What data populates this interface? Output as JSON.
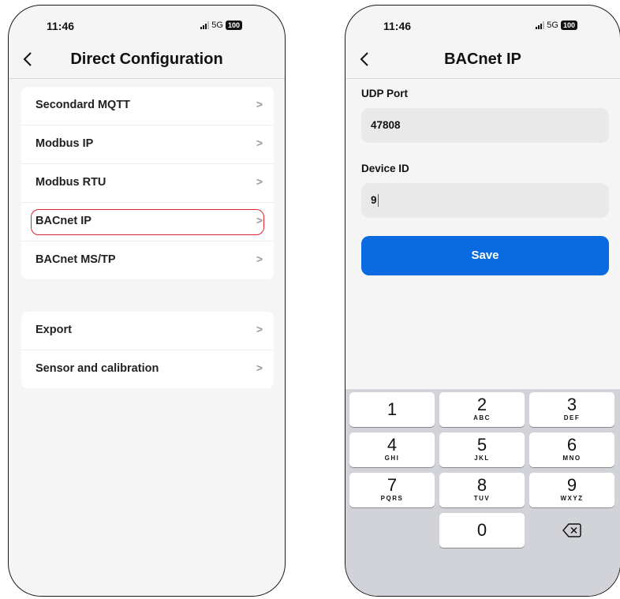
{
  "left_screen": {
    "status": {
      "time": "11:46",
      "network": "5G",
      "battery": "100"
    },
    "nav_title": "Direct Configuration",
    "group1": [
      {
        "label": "Secondard MQTT"
      },
      {
        "label": "Modbus IP"
      },
      {
        "label": "Modbus RTU"
      },
      {
        "label": "BACnet IP",
        "highlighted": true
      },
      {
        "label": "BACnet MS/TP"
      }
    ],
    "group2": [
      {
        "label": "Export"
      },
      {
        "label": "Sensor and calibration"
      }
    ],
    "chevron": ">"
  },
  "right_screen": {
    "status": {
      "time": "11:46",
      "network": "5G",
      "battery": "100"
    },
    "nav_title": "BACnet IP",
    "udp_port_label": "UDP Port",
    "udp_port_value": "47808",
    "device_id_label": "Device ID",
    "device_id_value": "9",
    "save_label": "Save",
    "keypad": [
      {
        "digit": "1",
        "letters": ""
      },
      {
        "digit": "2",
        "letters": "ABC"
      },
      {
        "digit": "3",
        "letters": "DEF"
      },
      {
        "digit": "4",
        "letters": "GHI"
      },
      {
        "digit": "5",
        "letters": "JKL"
      },
      {
        "digit": "6",
        "letters": "MNO"
      },
      {
        "digit": "7",
        "letters": "PQRS"
      },
      {
        "digit": "8",
        "letters": "TUV"
      },
      {
        "digit": "9",
        "letters": "WXYZ"
      },
      {
        "digit": "0",
        "letters": ""
      }
    ],
    "delete_icon": "backspace-icon"
  },
  "colors": {
    "accent": "#0a6adf",
    "highlight": "#e0262e",
    "background": "#f5f5f5"
  }
}
